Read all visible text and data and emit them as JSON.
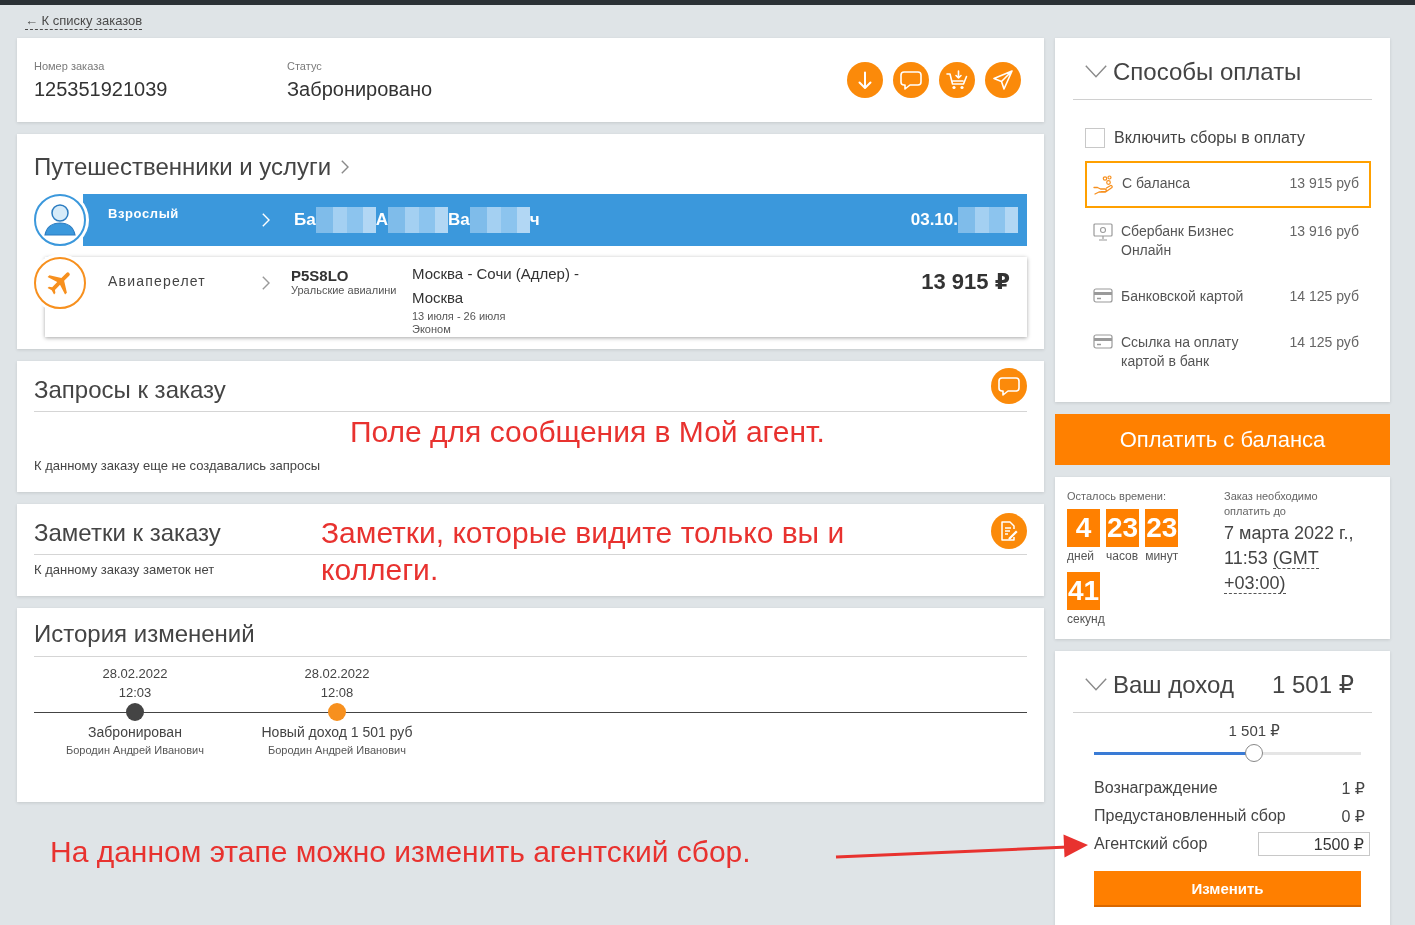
{
  "back_link": {
    "label": "← К списку заказов"
  },
  "order": {
    "fields": [
      {
        "label": "Номер заказа",
        "value": "125351921039"
      },
      {
        "label": "Статус",
        "value": "Забронировано"
      }
    ],
    "actions": [
      {
        "kind": "download"
      },
      {
        "kind": "chat"
      },
      {
        "kind": "cart"
      },
      {
        "kind": "send"
      }
    ]
  },
  "travelers": {
    "title": "Путешественники и услуги",
    "passenger": {
      "type": "Взрослый",
      "name": [
        {
          "kind": "text",
          "text": "Ба"
        },
        {
          "kind": "blurred"
        },
        {
          "kind": "text",
          "text": "А"
        },
        {
          "kind": "blurred"
        },
        {
          "kind": "text",
          "text": "Ва"
        },
        {
          "kind": "blurred"
        },
        {
          "kind": "text",
          "text": "ч"
        }
      ],
      "birth_date": [
        {
          "kind": "text",
          "text": "03.10."
        },
        {
          "kind": "blurred"
        }
      ]
    },
    "service": {
      "type": "Авиаперелет",
      "booking_code": "P5S8LO",
      "airline": "Уральские авиалини",
      "route": "Москва - Сочи (Адлер) - Москва",
      "dates": "13 июля - 26 июля",
      "fare_class": "Эконом",
      "price": "13 915 ₽"
    }
  },
  "requests": {
    "title": "Запросы к заказу",
    "action": {
      "kind": "chat"
    },
    "annotation": "Поле для сообщения в Мой агент.",
    "empty_text": "К данному заказу еще не создавались запросы"
  },
  "notes": {
    "title": "Заметки к заказу",
    "action": {
      "kind": "note"
    },
    "annotation": "Заметки, которые видите только вы и коллеги.",
    "empty_text": "К данному заказу заметок нет"
  },
  "history": {
    "title": "История изменений",
    "events": [
      {
        "date": "28.02.2022",
        "time": "12:03",
        "title": "Забронирован",
        "author": "Бородин Андрей Иванович",
        "color": "#444444"
      },
      {
        "date": "28.02.2022",
        "time": "12:08",
        "title": "Новый доход 1 501 руб",
        "author": "Бородин Андрей Иванович",
        "color": "#f7901e"
      }
    ]
  },
  "footer_annotation": "На данном этапе можно изменить агентский сбор.",
  "payment": {
    "title": "Способы оплаты",
    "expanded": true,
    "include_fees": {
      "label": "Включить сборы в оплату",
      "checked": false
    },
    "methods": [
      {
        "kind": "balance",
        "label": "С баланса",
        "amount": "13 915 руб",
        "selected": true
      },
      {
        "kind": "online_bank",
        "label": "Сбербанк Бизнес Онлайн",
        "amount": "13 916 руб",
        "selected": false
      },
      {
        "kind": "card",
        "label": "Банковской картой",
        "amount": "14 125 руб",
        "selected": false
      },
      {
        "kind": "card",
        "label": "Ссылка на оплату картой в банк",
        "amount": "14 125 руб",
        "selected": false
      }
    ]
  },
  "pay_button": {
    "label": "Оплатить с баланса"
  },
  "timer": {
    "label": "Осталось времени:",
    "units": [
      {
        "value": "4",
        "label": "дней"
      },
      {
        "value": "23",
        "label": "часов"
      },
      {
        "value": "23",
        "label": "минут"
      },
      {
        "value": "41",
        "label": "секунд"
      }
    ],
    "deadline_label": "Заказ необходимо оплатить до",
    "deadline": "7 марта 2022 г., 11:53",
    "timezone": "(GMT +03:00)"
  },
  "income": {
    "title": "Ваш доход",
    "total": "1 501 ₽",
    "expanded": true,
    "slider": {
      "reading": "1 501 ₽",
      "level": 0.6
    },
    "rows": [
      {
        "kind": "value",
        "label": "Вознаграждение",
        "value": "1 ₽"
      },
      {
        "kind": "value",
        "label": "Предустановленный сбор",
        "value": "0 ₽"
      },
      {
        "kind": "input",
        "label": "Агентский сбор",
        "value": "1500 ₽"
      }
    ],
    "button": "Изменить"
  }
}
